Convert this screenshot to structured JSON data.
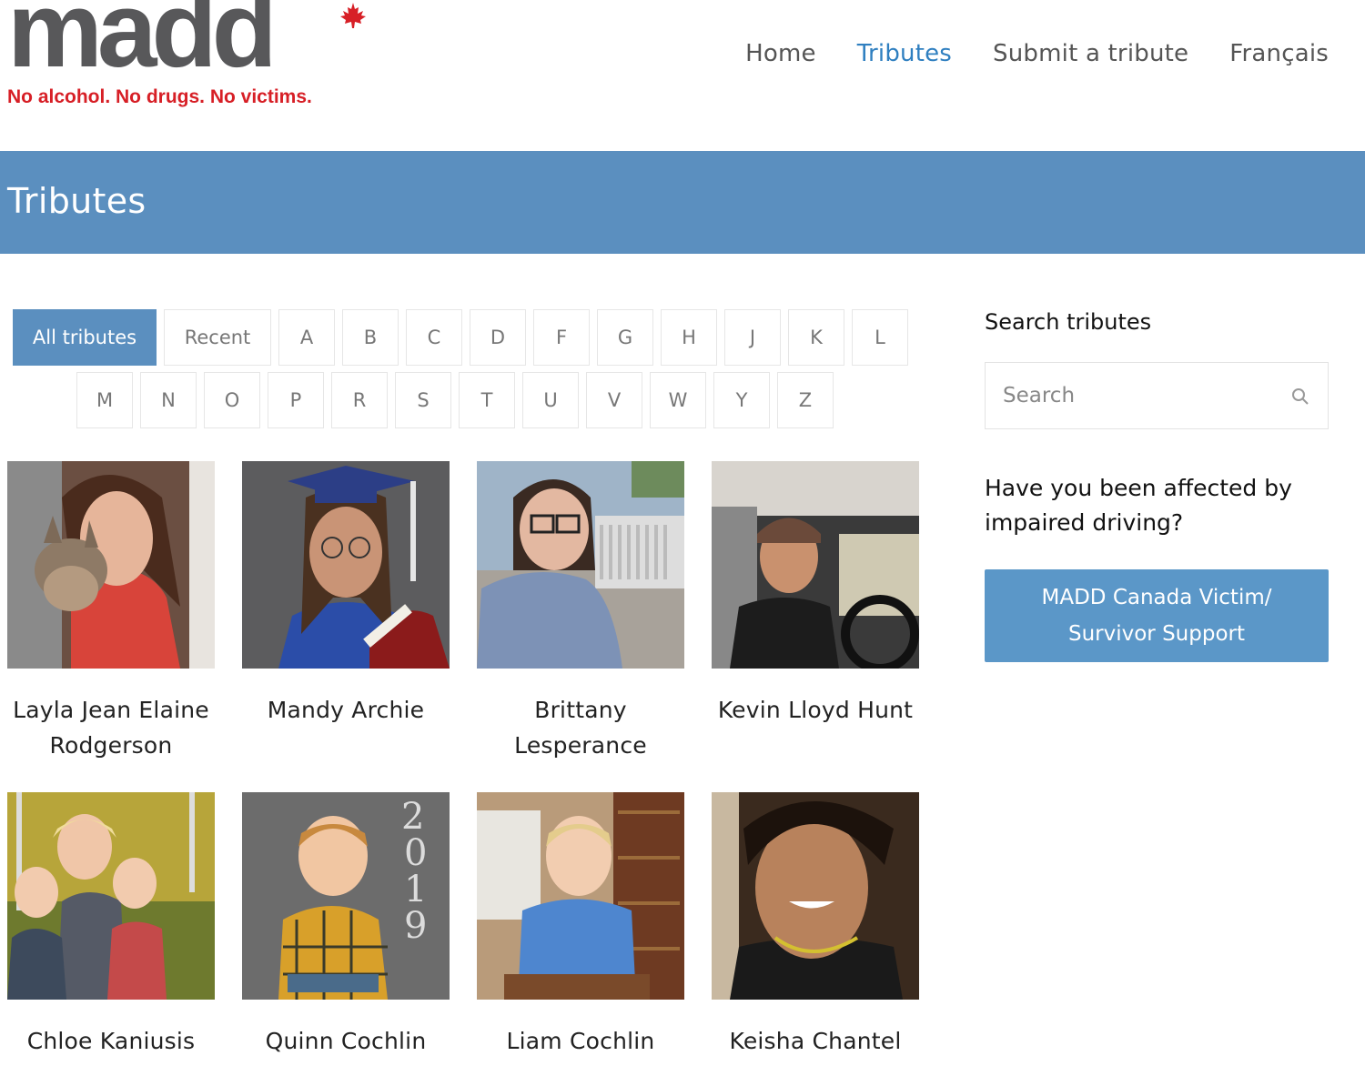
{
  "logo": {
    "wordmark": "madd",
    "tagline": "No alcohol. No drugs. No victims."
  },
  "nav": [
    {
      "label": "Home",
      "active": false
    },
    {
      "label": "Tributes",
      "active": true
    },
    {
      "label": "Submit a tribute",
      "active": false
    },
    {
      "label": "Français",
      "active": false
    }
  ],
  "banner": {
    "title": "Tributes"
  },
  "filters": {
    "row1": [
      "All tributes",
      "Recent",
      "A",
      "B",
      "C",
      "D",
      "F",
      "G",
      "H",
      "J",
      "K",
      "L"
    ],
    "row2": [
      "M",
      "N",
      "O",
      "P",
      "R",
      "S",
      "T",
      "U",
      "V",
      "W",
      "Y",
      "Z"
    ],
    "active": "All tributes"
  },
  "tributes": [
    {
      "name": "Layla Jean Elaine Rodgerson"
    },
    {
      "name": "Mandy Archie"
    },
    {
      "name": "Brittany Lesperance"
    },
    {
      "name": "Kevin Lloyd Hunt"
    },
    {
      "name": "Chloe Kaniusis"
    },
    {
      "name": "Quinn Cochlin"
    },
    {
      "name": "Liam Cochlin"
    },
    {
      "name": "Keisha Chantel Tsekoh"
    }
  ],
  "sidebar": {
    "search_title": "Search tributes",
    "search_placeholder": "Search",
    "search_icon": "search-icon",
    "affected_text": "Have you been affected by impaired driving?",
    "support_button": "MADD Canada Victim/ Survivor Support"
  },
  "colors": {
    "accent": "#5b8fbf",
    "nav_active": "#2f7fc0",
    "logo_red": "#d71f26",
    "logo_gray": "#58585a"
  }
}
